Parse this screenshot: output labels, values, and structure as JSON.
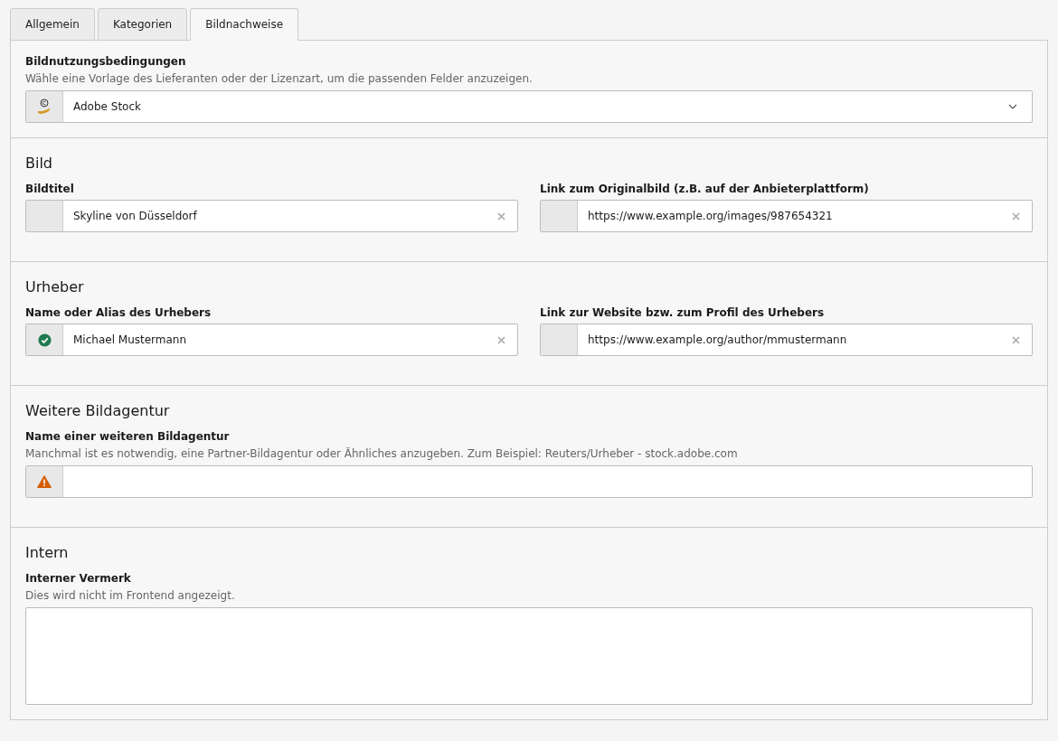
{
  "tabs": [
    {
      "label": "Allgemein",
      "selected": false
    },
    {
      "label": "Kategorien",
      "selected": false
    },
    {
      "label": "Bildnachweise",
      "selected": true
    }
  ],
  "sections": [
    {
      "rows": [
        [
          {
            "label": "Bildnutzungsbedingungen",
            "description": "Wähle eine Vorlage des Lieferanten oder der Lizenzart, um die passenden Felder anzuzeigen.",
            "kind": "select",
            "addon": {
              "kind": "license"
            },
            "value": "Adobe Stock"
          }
        ]
      ]
    },
    {
      "heading": "Bild",
      "rows": [
        [
          {
            "label": "Bildtitel",
            "kind": "text",
            "addon": {
              "kind": "none"
            },
            "value": "Skyline von Düsseldorf"
          },
          {
            "label": "Link zum Originalbild (z.B. auf der Anbieterplattform)",
            "kind": "text",
            "addon": {
              "kind": "none"
            },
            "value": "https://www.example.org/images/987654321"
          }
        ]
      ]
    },
    {
      "heading": "Urheber",
      "rows": [
        [
          {
            "label": "Name oder Alias des Urhebers",
            "kind": "text",
            "addon": {
              "kind": "success"
            },
            "value": "Michael Mustermann"
          },
          {
            "label": "Link zur Website bzw. zum Profil des Urhebers",
            "kind": "text",
            "addon": {
              "kind": "none"
            },
            "value": "https://www.example.org/author/mmustermann"
          }
        ]
      ]
    },
    {
      "heading": "Weitere Bildagentur",
      "rows": [
        [
          {
            "label": "Name einer weiteren Bildagentur",
            "description": "Manchmal ist es notwendig, eine Partner-Bildagentur oder Ähnliches anzugeben. Zum Beispiel: Reuters/Urheber - stock.adobe.com",
            "kind": "text",
            "addon": {
              "kind": "warning"
            }
          }
        ]
      ]
    },
    {
      "heading": "Intern",
      "rows": [
        [
          {
            "label": "Interner Vermerk",
            "description": "Dies wird nicht im Frontend angezeigt.",
            "kind": "textarea"
          }
        ]
      ]
    }
  ]
}
